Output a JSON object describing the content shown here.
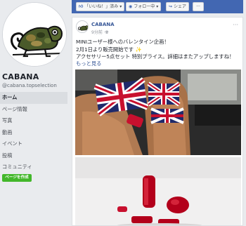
{
  "page": {
    "name": "CABANA",
    "handle": "@cabana.topselection"
  },
  "nav": [
    {
      "label": "ホーム",
      "active": true
    },
    {
      "label": "ページ情報",
      "active": false
    },
    {
      "label": "写真",
      "active": false
    },
    {
      "label": "動画",
      "active": false
    },
    {
      "label": "イベント",
      "active": false
    },
    {
      "label": "投稿",
      "active": false
    },
    {
      "label": "コミュニティ",
      "active": false
    }
  ],
  "create_page_label": "ページを作成",
  "actions": {
    "like": "「いいね！」済み",
    "follow": "フォロー中",
    "share": "シェア",
    "more": "···"
  },
  "post": {
    "author": "CABANA",
    "time": "9分前",
    "more": "···",
    "lines": [
      "MINIユーザー様へのバレンタイン企画！",
      "2月1日より販売開始です",
      "アクセサリー5点セット 特別プライス。詳細はまたアップしますね！"
    ],
    "see_more": "もっと見る"
  },
  "colors": {
    "brand": "#4267b2",
    "link": "#385898",
    "create_button": "#42b72a"
  },
  "icons": {
    "like": "thumbs-up-icon",
    "follow": "rss-icon",
    "share": "share-arrow-icon",
    "sparkle": "sparkle-icon",
    "globe": "globe-icon"
  }
}
